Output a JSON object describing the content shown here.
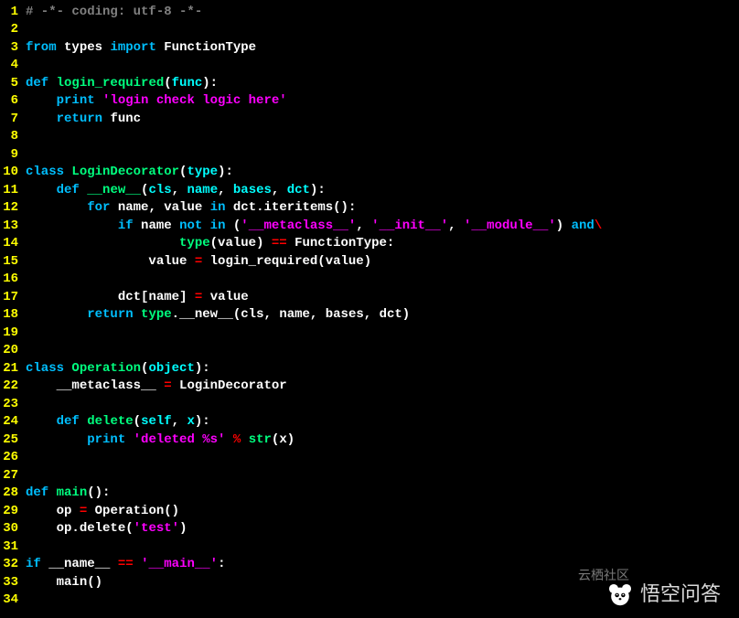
{
  "lines": [
    {
      "n": 1,
      "tokens": [
        [
          "comment",
          "# -*- coding: utf-8 -*-"
        ]
      ]
    },
    {
      "n": 2,
      "tokens": []
    },
    {
      "n": 3,
      "tokens": [
        [
          "keyword",
          "from"
        ],
        [
          "white",
          " "
        ],
        [
          "ident",
          "types"
        ],
        [
          "white",
          " "
        ],
        [
          "keyword",
          "import"
        ],
        [
          "white",
          " "
        ],
        [
          "ident",
          "FunctionType"
        ]
      ]
    },
    {
      "n": 4,
      "tokens": []
    },
    {
      "n": 5,
      "tokens": [
        [
          "keyword",
          "def"
        ],
        [
          "white",
          " "
        ],
        [
          "func-name",
          "login_required"
        ],
        [
          "punct",
          "("
        ],
        [
          "param",
          "func"
        ],
        [
          "punct",
          "):"
        ]
      ]
    },
    {
      "n": 6,
      "tokens": [
        [
          "white",
          "    "
        ],
        [
          "keyword",
          "print"
        ],
        [
          "white",
          " "
        ],
        [
          "string",
          "'login check logic here'"
        ]
      ]
    },
    {
      "n": 7,
      "tokens": [
        [
          "white",
          "    "
        ],
        [
          "keyword",
          "return"
        ],
        [
          "white",
          " "
        ],
        [
          "ident",
          "func"
        ]
      ]
    },
    {
      "n": 8,
      "tokens": []
    },
    {
      "n": 9,
      "tokens": []
    },
    {
      "n": 10,
      "tokens": [
        [
          "keyword",
          "class"
        ],
        [
          "white",
          " "
        ],
        [
          "class-name",
          "LoginDecorator"
        ],
        [
          "punct",
          "("
        ],
        [
          "param",
          "type"
        ],
        [
          "punct",
          "):"
        ]
      ]
    },
    {
      "n": 11,
      "tokens": [
        [
          "white",
          "    "
        ],
        [
          "keyword",
          "def"
        ],
        [
          "white",
          " "
        ],
        [
          "func-name",
          "__new__"
        ],
        [
          "punct",
          "("
        ],
        [
          "param",
          "cls"
        ],
        [
          "punct",
          ", "
        ],
        [
          "param",
          "name"
        ],
        [
          "punct",
          ", "
        ],
        [
          "param",
          "bases"
        ],
        [
          "punct",
          ", "
        ],
        [
          "param",
          "dct"
        ],
        [
          "punct",
          "):"
        ]
      ]
    },
    {
      "n": 12,
      "tokens": [
        [
          "white",
          "        "
        ],
        [
          "keyword",
          "for"
        ],
        [
          "white",
          " "
        ],
        [
          "ident",
          "name"
        ],
        [
          "punct",
          ", "
        ],
        [
          "ident",
          "value"
        ],
        [
          "white",
          " "
        ],
        [
          "keyword",
          "in"
        ],
        [
          "white",
          " "
        ],
        [
          "ident",
          "dct"
        ],
        [
          "punct",
          "."
        ],
        [
          "ident",
          "iteritems"
        ],
        [
          "punct",
          "():"
        ]
      ]
    },
    {
      "n": 13,
      "tokens": [
        [
          "white",
          "            "
        ],
        [
          "keyword",
          "if"
        ],
        [
          "white",
          " "
        ],
        [
          "ident",
          "name"
        ],
        [
          "white",
          " "
        ],
        [
          "keyword",
          "not in"
        ],
        [
          "white",
          " "
        ],
        [
          "punct",
          "("
        ],
        [
          "string",
          "'__metaclass__'"
        ],
        [
          "punct",
          ", "
        ],
        [
          "string",
          "'__init__'"
        ],
        [
          "punct",
          ", "
        ],
        [
          "string",
          "'__module__'"
        ],
        [
          "punct",
          ") "
        ],
        [
          "keyword",
          "and"
        ],
        [
          "cont",
          "\\"
        ]
      ]
    },
    {
      "n": 14,
      "tokens": [
        [
          "white",
          "                    "
        ],
        [
          "builtin",
          "type"
        ],
        [
          "punct",
          "("
        ],
        [
          "ident",
          "value"
        ],
        [
          "punct",
          ") "
        ],
        [
          "operator",
          "=="
        ],
        [
          "white",
          " "
        ],
        [
          "ident",
          "FunctionType"
        ],
        [
          "punct",
          ":"
        ]
      ]
    },
    {
      "n": 15,
      "tokens": [
        [
          "white",
          "                "
        ],
        [
          "ident",
          "value"
        ],
        [
          "white",
          " "
        ],
        [
          "operator",
          "="
        ],
        [
          "white",
          " "
        ],
        [
          "ident",
          "login_required"
        ],
        [
          "punct",
          "("
        ],
        [
          "ident",
          "value"
        ],
        [
          "punct",
          ")"
        ]
      ]
    },
    {
      "n": 16,
      "tokens": []
    },
    {
      "n": 17,
      "tokens": [
        [
          "white",
          "            "
        ],
        [
          "ident",
          "dct"
        ],
        [
          "punct",
          "["
        ],
        [
          "ident",
          "name"
        ],
        [
          "punct",
          "] "
        ],
        [
          "operator",
          "="
        ],
        [
          "white",
          " "
        ],
        [
          "ident",
          "value"
        ]
      ]
    },
    {
      "n": 18,
      "tokens": [
        [
          "white",
          "        "
        ],
        [
          "keyword",
          "return"
        ],
        [
          "white",
          " "
        ],
        [
          "builtin",
          "type"
        ],
        [
          "punct",
          "."
        ],
        [
          "ident",
          "__new__"
        ],
        [
          "punct",
          "("
        ],
        [
          "ident",
          "cls"
        ],
        [
          "punct",
          ", "
        ],
        [
          "ident",
          "name"
        ],
        [
          "punct",
          ", "
        ],
        [
          "ident",
          "bases"
        ],
        [
          "punct",
          ", "
        ],
        [
          "ident",
          "dct"
        ],
        [
          "punct",
          ")"
        ]
      ]
    },
    {
      "n": 19,
      "tokens": []
    },
    {
      "n": 20,
      "tokens": []
    },
    {
      "n": 21,
      "tokens": [
        [
          "keyword",
          "class"
        ],
        [
          "white",
          " "
        ],
        [
          "class-name",
          "Operation"
        ],
        [
          "punct",
          "("
        ],
        [
          "param",
          "object"
        ],
        [
          "punct",
          "):"
        ]
      ]
    },
    {
      "n": 22,
      "tokens": [
        [
          "white",
          "    "
        ],
        [
          "ident",
          "__metaclass__"
        ],
        [
          "white",
          " "
        ],
        [
          "operator",
          "="
        ],
        [
          "white",
          " "
        ],
        [
          "ident",
          "LoginDecorator"
        ]
      ]
    },
    {
      "n": 23,
      "tokens": []
    },
    {
      "n": 24,
      "tokens": [
        [
          "white",
          "    "
        ],
        [
          "keyword",
          "def"
        ],
        [
          "white",
          " "
        ],
        [
          "func-name",
          "delete"
        ],
        [
          "punct",
          "("
        ],
        [
          "param",
          "self"
        ],
        [
          "punct",
          ", "
        ],
        [
          "param",
          "x"
        ],
        [
          "punct",
          "):"
        ]
      ]
    },
    {
      "n": 25,
      "tokens": [
        [
          "white",
          "        "
        ],
        [
          "keyword",
          "print"
        ],
        [
          "white",
          " "
        ],
        [
          "string",
          "'deleted %s'"
        ],
        [
          "white",
          " "
        ],
        [
          "operator",
          "%"
        ],
        [
          "white",
          " "
        ],
        [
          "builtin",
          "str"
        ],
        [
          "punct",
          "("
        ],
        [
          "ident",
          "x"
        ],
        [
          "punct",
          ")"
        ]
      ]
    },
    {
      "n": 26,
      "tokens": []
    },
    {
      "n": 27,
      "tokens": []
    },
    {
      "n": 28,
      "tokens": [
        [
          "keyword",
          "def"
        ],
        [
          "white",
          " "
        ],
        [
          "func-name",
          "main"
        ],
        [
          "punct",
          "():"
        ]
      ]
    },
    {
      "n": 29,
      "tokens": [
        [
          "white",
          "    "
        ],
        [
          "ident",
          "op"
        ],
        [
          "white",
          " "
        ],
        [
          "operator",
          "="
        ],
        [
          "white",
          " "
        ],
        [
          "ident",
          "Operation"
        ],
        [
          "punct",
          "()"
        ]
      ]
    },
    {
      "n": 30,
      "tokens": [
        [
          "white",
          "    "
        ],
        [
          "ident",
          "op"
        ],
        [
          "punct",
          "."
        ],
        [
          "ident",
          "delete"
        ],
        [
          "punct",
          "("
        ],
        [
          "string",
          "'test'"
        ],
        [
          "punct",
          ")"
        ]
      ]
    },
    {
      "n": 31,
      "tokens": []
    },
    {
      "n": 32,
      "tokens": [
        [
          "keyword",
          "if"
        ],
        [
          "white",
          " "
        ],
        [
          "ident",
          "__name__"
        ],
        [
          "white",
          " "
        ],
        [
          "operator",
          "=="
        ],
        [
          "white",
          " "
        ],
        [
          "string",
          "'__main__'"
        ],
        [
          "punct",
          ":"
        ]
      ]
    },
    {
      "n": 33,
      "tokens": [
        [
          "white",
          "    "
        ],
        [
          "ident",
          "main"
        ],
        [
          "punct",
          "()"
        ]
      ]
    },
    {
      "n": 34,
      "tokens": []
    }
  ],
  "watermark": {
    "sub": "云栖社区",
    "main": "悟空问答"
  }
}
